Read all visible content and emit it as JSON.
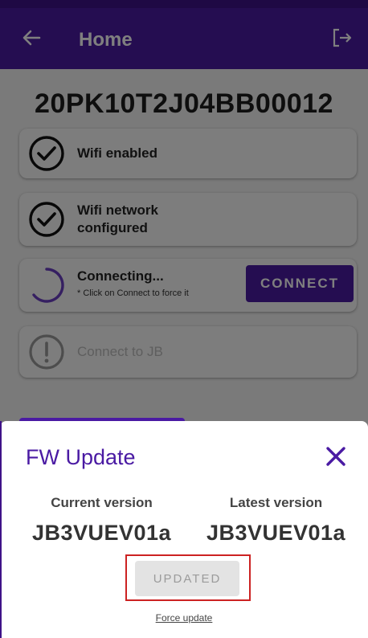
{
  "appbar": {
    "title": "Home",
    "back_icon": "arrow-left-icon",
    "logout_icon": "logout-icon"
  },
  "device": {
    "id": "20PK10T2J04BB00012"
  },
  "steps": [
    {
      "label": "Wifi enabled",
      "status": "done",
      "icon": "check-circle-icon"
    },
    {
      "label": "Wifi network configured",
      "label_line1": "Wifi network",
      "label_line2": "configured",
      "status": "done",
      "icon": "check-circle-icon"
    },
    {
      "label": "Connecting...",
      "sublabel": "* Click on Connect to force it",
      "status": "in-progress",
      "icon": "spinner-icon",
      "button": "CONNECT"
    },
    {
      "label": "Connect to JB",
      "status": "pending",
      "icon": "exclamation-circle-icon"
    }
  ],
  "fw_update": {
    "title": "FW Update",
    "close_icon": "close-icon",
    "current_label": "Current version",
    "current_value": "JB3VUEV01a",
    "latest_label": "Latest version",
    "latest_value": "JB3VUEV01a",
    "status_button": "UPDATED",
    "force_link": "Force update"
  },
  "colors": {
    "primary": "#4a1aa3",
    "highlight": "#cc2222"
  }
}
